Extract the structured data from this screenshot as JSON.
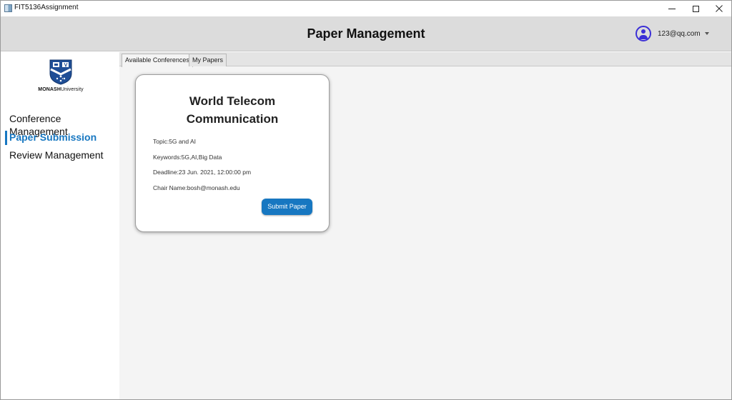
{
  "window": {
    "title": "FIT5136Assignment"
  },
  "header": {
    "title": "Paper Management",
    "user_email": "123@qq.com"
  },
  "sidebar": {
    "logo_brand": "MONASH",
    "logo_suffix": "University",
    "items": [
      {
        "label": "Conference Management",
        "active": false
      },
      {
        "label": "Paper Submission",
        "active": true
      },
      {
        "label": "Review Management",
        "active": false
      }
    ]
  },
  "tabs": [
    {
      "label": "Available Conferences",
      "active": true
    },
    {
      "label": "My Papers",
      "active": false
    }
  ],
  "conference": {
    "title_line1": "World Telecom",
    "title_line2": "Communication",
    "topic": "Topic:5G and AI",
    "keywords": "Keywords:5G,AI,Big Data",
    "deadline": "Deadline:23 Jun. 2021, 12:00:00 pm",
    "chair": "Chair Name:bosh@monash.edu",
    "submit_label": "Submit Paper"
  },
  "colors": {
    "accent": "#1777c1",
    "avatar": "#3b2fd6",
    "header_bg": "#dcdcdc",
    "content_bg": "#f4f4f4"
  },
  "icons": [
    "app-icon",
    "minimize-icon",
    "maximize-icon",
    "close-icon",
    "user-avatar-icon",
    "chevron-down-icon",
    "monash-crest-icon"
  ]
}
